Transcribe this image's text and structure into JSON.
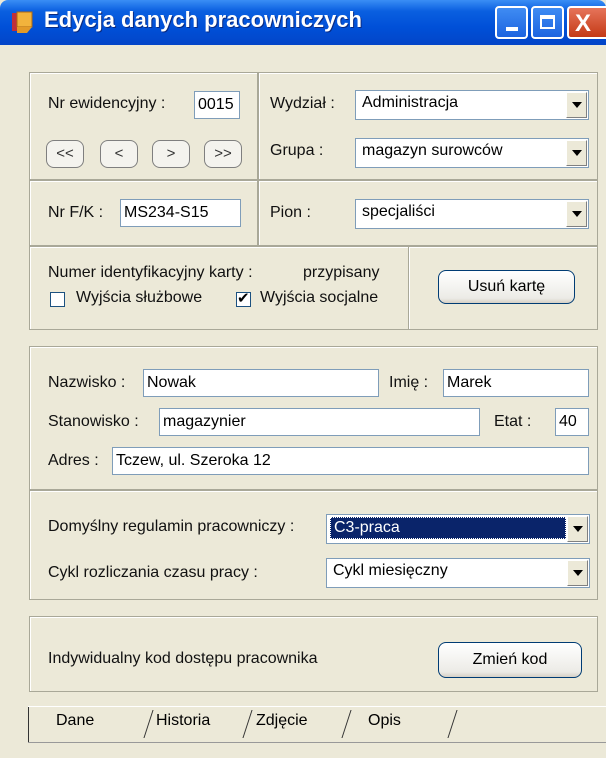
{
  "window": {
    "title": "Edycja danych pracowniczych",
    "icon": "app-folder-icon",
    "buttons": {
      "minimize": "minimize-icon",
      "maximize": "maximize-icon",
      "close": "close-icon",
      "close_glyph": "X"
    }
  },
  "record": {
    "nr_ewid_label": "Nr ewidencyjny :",
    "nr_ewid_value": "0015",
    "nav": [
      "<<",
      "<",
      ">",
      ">>"
    ],
    "wydzial_label": "Wydział :",
    "wydzial_value": "Administracja",
    "grupa_label": "Grupa :",
    "grupa_value": "magazyn surowców",
    "nrfk_label": "Nr F/K :",
    "nrfk_value": "MS234-S15",
    "pion_label": "Pion :",
    "pion_value": "specjaliści"
  },
  "card": {
    "label": "Numer identyfikacyjny karty :",
    "status": "przypisany",
    "wyjscia_sluzbowe_label": "Wyjścia służbowe",
    "wyjscia_sluzbowe_checked": false,
    "wyjscia_socjalne_label": "Wyjścia socjalne",
    "wyjscia_socjalne_checked": true,
    "remove_button": "Usuń kartę"
  },
  "person": {
    "nazwisko_label": "Nazwisko :",
    "nazwisko_value": "Nowak",
    "imie_label": "Imię :",
    "imie_value": "Marek",
    "stanowisko_label": "Stanowisko :",
    "stanowisko_value": "magazynier",
    "etat_label": "Etat :",
    "etat_value": "40",
    "adres_label": "Adres :",
    "adres_value": "Tczew, ul. Szeroka 12"
  },
  "rules": {
    "regulamin_label": "Domyślny regulamin pracowniczy :",
    "regulamin_value": "C3-praca",
    "cykl_label": "Cykl rozliczania czasu pracy :",
    "cykl_value": "Cykl miesięczny"
  },
  "access": {
    "label": "Indywidualny kod dostępu pracownika",
    "button": "Zmień kod"
  },
  "tabs": [
    "Dane",
    "Historia",
    "Zdjęcie",
    "Opis"
  ]
}
